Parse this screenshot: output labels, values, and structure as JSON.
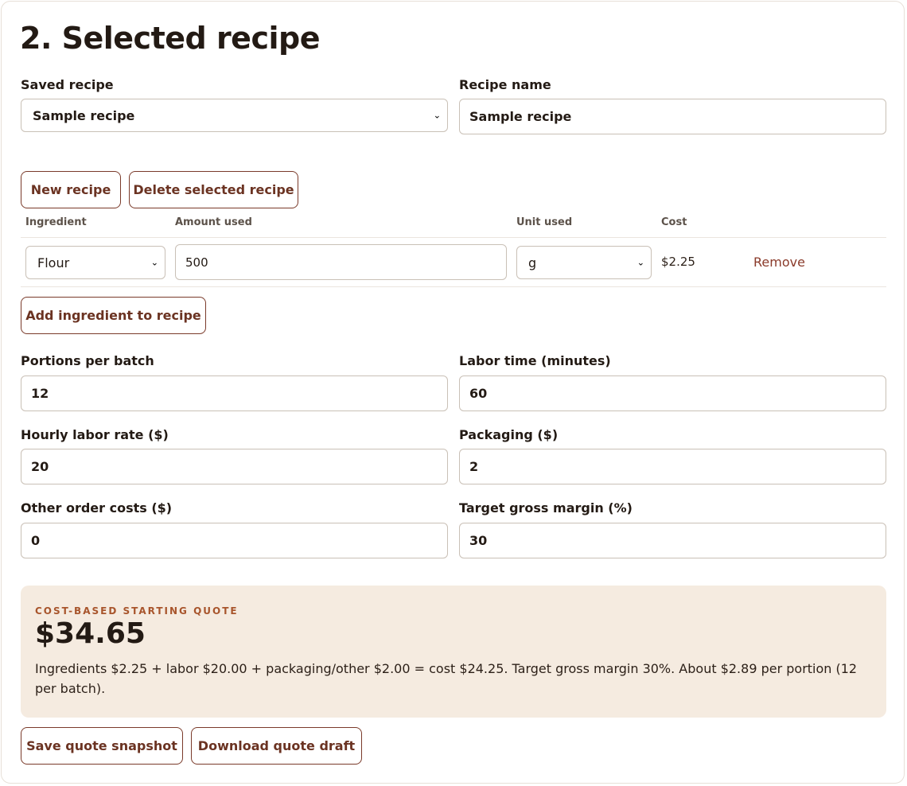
{
  "section_title": "2. Selected recipe",
  "saved_recipe": {
    "label": "Saved recipe",
    "value": "Sample recipe"
  },
  "recipe_name": {
    "label": "Recipe name",
    "value": "Sample recipe"
  },
  "buttons": {
    "new_recipe": "New recipe",
    "delete_recipe": "Delete selected recipe",
    "add_ingredient": "Add ingredient to recipe",
    "save_snapshot": "Save quote snapshot",
    "download_draft": "Download quote draft"
  },
  "ingredients_table": {
    "headers": {
      "ingredient": "Ingredient",
      "amount": "Amount used",
      "unit": "Unit used",
      "cost": "Cost"
    },
    "rows": [
      {
        "ingredient": "Flour",
        "amount": "500",
        "unit": "g",
        "cost": "$2.25",
        "remove": "Remove"
      }
    ]
  },
  "fields": {
    "portions": {
      "label": "Portions per batch",
      "value": "12"
    },
    "labor_time": {
      "label": "Labor time (minutes)",
      "value": "60"
    },
    "labor_rate": {
      "label": "Hourly labor rate ($)",
      "value": "20"
    },
    "packaging": {
      "label": "Packaging ($)",
      "value": "2"
    },
    "other_costs": {
      "label": "Other order costs ($)",
      "value": "0"
    },
    "target_margin": {
      "label": "Target gross margin (%)",
      "value": "30"
    }
  },
  "quote": {
    "kicker": "COST-BASED STARTING QUOTE",
    "amount": "$34.65",
    "detail": "Ingredients $2.25 + labor $20.00 + packaging/other $2.00 = cost $24.25. Target gross margin 30%. About $2.89 per portion (12 per batch)."
  },
  "colors": {
    "accent": "#6b3322",
    "quote_bg": "#f5ebe0",
    "kicker": "#a8552c"
  }
}
